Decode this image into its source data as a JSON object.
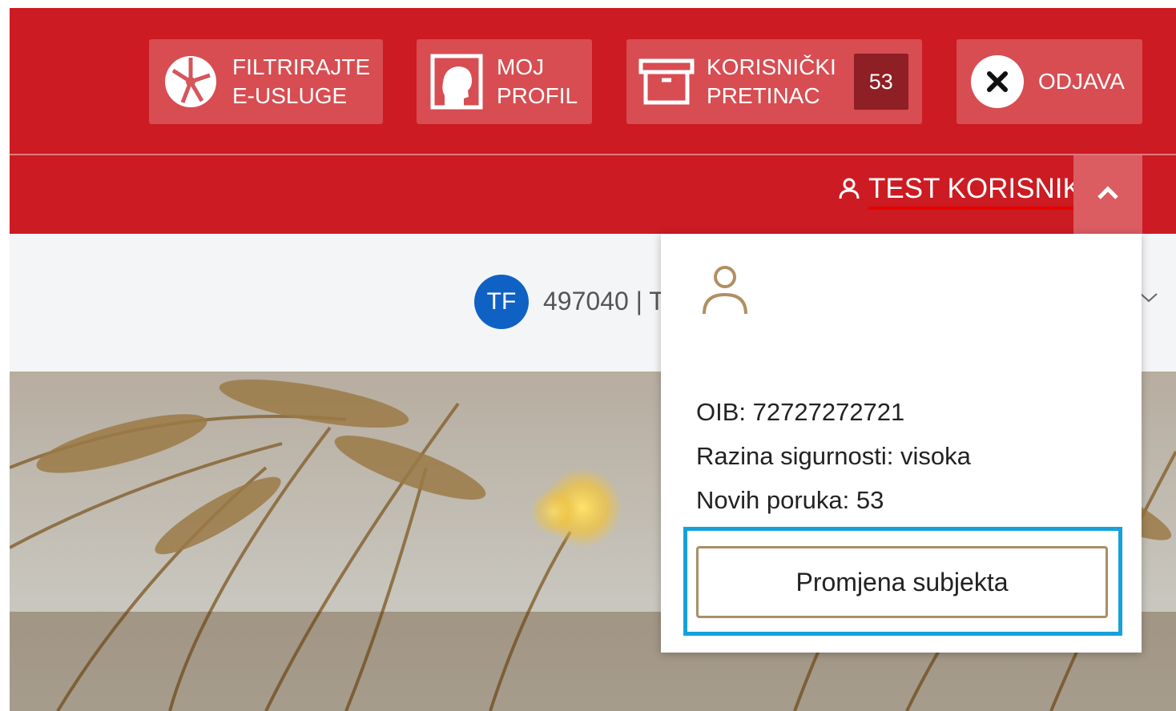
{
  "nav": {
    "filter": {
      "line1": "FILTRIRAJTE",
      "line2": "E-USLUGE",
      "icon": "globe-icon"
    },
    "profile": {
      "line1": "MOJ",
      "line2": "PROFIL",
      "icon": "profile-head-icon"
    },
    "inbox": {
      "line1": "KORISNIČKI",
      "line2": "PRETINAC",
      "badge": "53",
      "icon": "archive-box-icon"
    },
    "logout": {
      "label": "ODJAVA",
      "icon": "close-icon"
    }
  },
  "user": {
    "name": "TEST KORISNIK",
    "icon": "user-icon"
  },
  "subject": {
    "initials": "TF",
    "text": "497040 | T",
    "accent": "#1061c4"
  },
  "dropdown": {
    "oib": "OIB: 72727272721",
    "security": "Razina sigurnosti: visoka",
    "messages": "Novih poruka: 53",
    "change_button": "Promjena subjekta"
  },
  "colors": {
    "brand_red": "#cc1b22",
    "focus_outline": "#16a1dd",
    "avatar_blue": "#1061c4"
  }
}
